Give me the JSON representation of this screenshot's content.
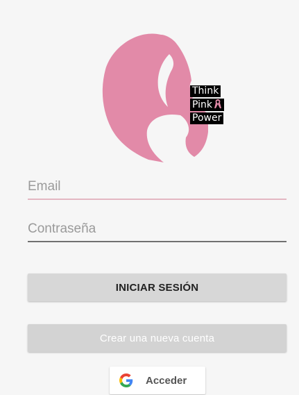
{
  "logo": {
    "tagline": [
      "Think",
      "Pink",
      "Power"
    ],
    "brand_color": "#e28aa8",
    "icon": "woman-silhouette-icon"
  },
  "form": {
    "email_placeholder": "Email",
    "password_placeholder": "Contraseña"
  },
  "buttons": {
    "login_label": "INICIAR SESIÓN",
    "create_label": "Crear una nueva cuenta",
    "google_label": "Acceder",
    "google_icon": "google-g-icon",
    "ribbon_icon": "awareness-ribbon-icon"
  }
}
